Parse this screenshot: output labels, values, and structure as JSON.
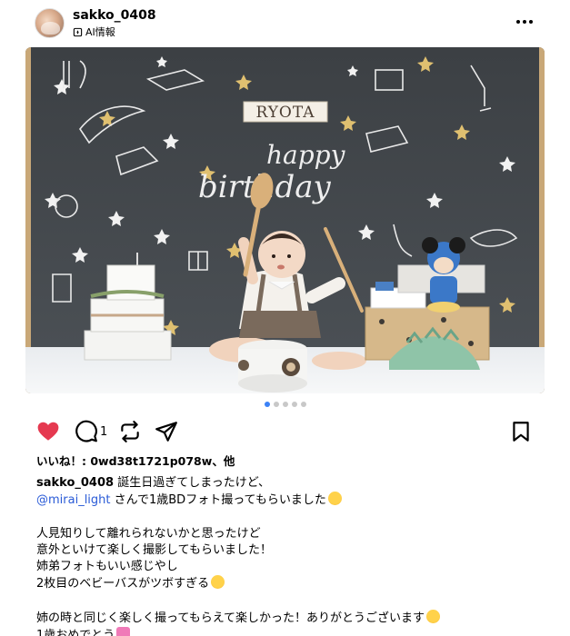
{
  "post": {
    "username": "sakko_0408",
    "ai_info_label": "AI情報"
  },
  "icons": {
    "more": "more-horizontal-icon",
    "like": "heart-icon",
    "comment": "comment-icon",
    "repost": "repost-icon",
    "share": "send-icon",
    "save": "bookmark-icon"
  },
  "photo": {
    "banner_text": "RYOTA",
    "chalk_text_1": "happy",
    "chalk_text_2": "birthday"
  },
  "carousel": {
    "total": 5,
    "active_index": 0
  },
  "actions": {
    "comment_count": "1",
    "liked": true,
    "like_color": "#e53950"
  },
  "caption": {
    "likes_prefix": "いいね！: ",
    "likes_user": "0wd38t1721p078w",
    "likes_suffix": "、他",
    "author": "sakko_0408",
    "line1_text": " 誕生日過ぎてしまったけど、",
    "mention": "@mirai_light",
    "line2_text": " さんで1歳BDフォト撮ってもらいました",
    "line3": "人見知りして離れられないかと思ったけど",
    "line4": "意外といけて楽しく撮影してもらいました！",
    "line5": "姉弟フォトもいい感じやし",
    "line6": "2枚目のベビーバスがツボすぎる",
    "line7": "姉の時と同じく楽しく撮ってもらえて楽しかった！ありがとうございます",
    "line8": "1歳おめでとう"
  }
}
